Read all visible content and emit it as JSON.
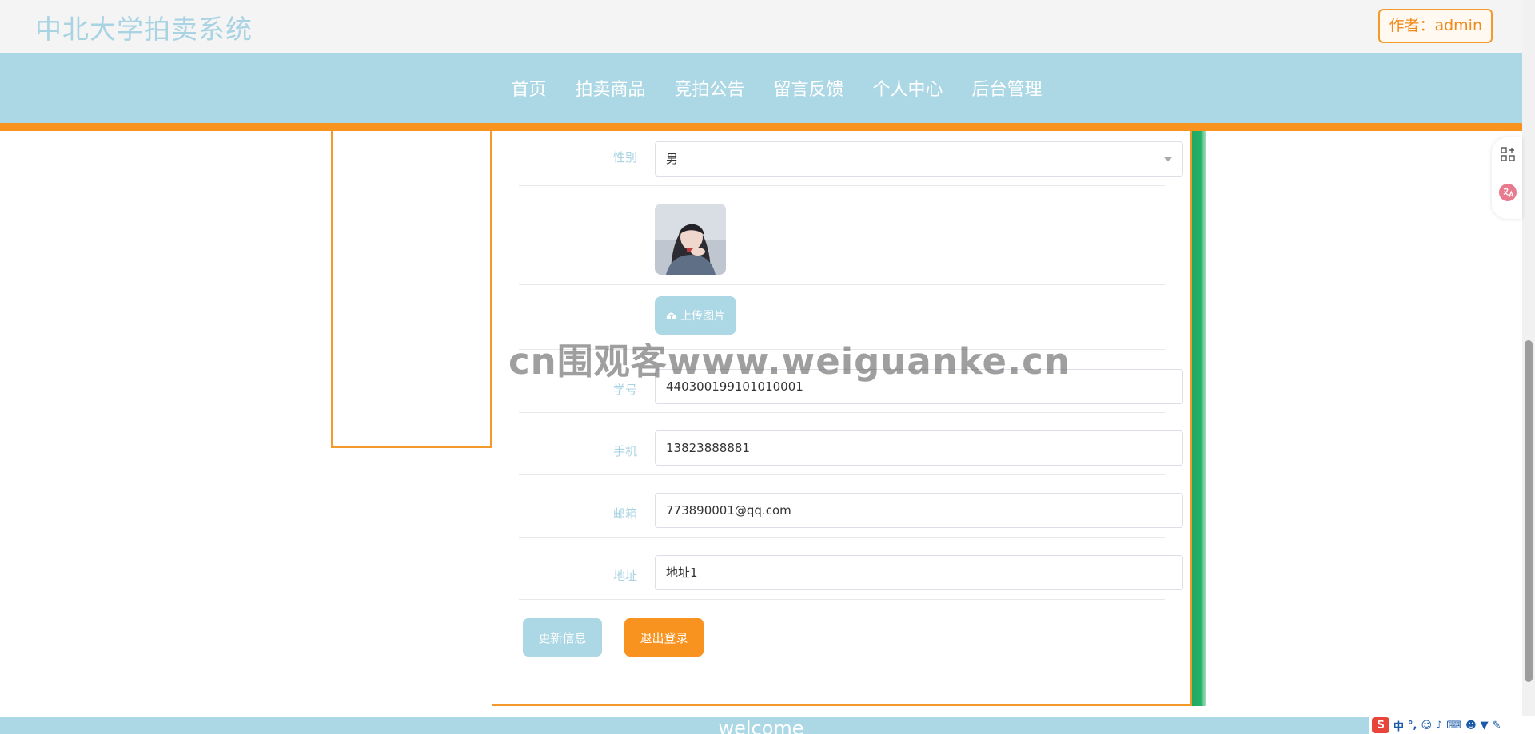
{
  "header": {
    "logo": "中北大学拍卖系统",
    "author": "作者：admin"
  },
  "nav": [
    "首页",
    "拍卖商品",
    "竞拍公告",
    "留言反馈",
    "个人中心",
    "后台管理"
  ],
  "form": {
    "gender_label": "性别",
    "gender_value": "男",
    "upload_label": "上传图片",
    "student_id_label": "学号",
    "student_id_value": "440300199101010001",
    "phone_label": "手机",
    "phone_value": "13823888881",
    "email_label": "邮箱",
    "email_value": "773890001@qq.com",
    "address_label": "地址",
    "address_value": "地址1",
    "update_button": "更新信息",
    "logout_button": "退出登录"
  },
  "watermark": "cn围观客www.weiguanke.cn",
  "footer": "welcome",
  "ime": {
    "lang": "中"
  },
  "colors": {
    "accent_blue": "#acd7e4",
    "accent_orange": "#f7931e",
    "green": "#1fa964"
  }
}
